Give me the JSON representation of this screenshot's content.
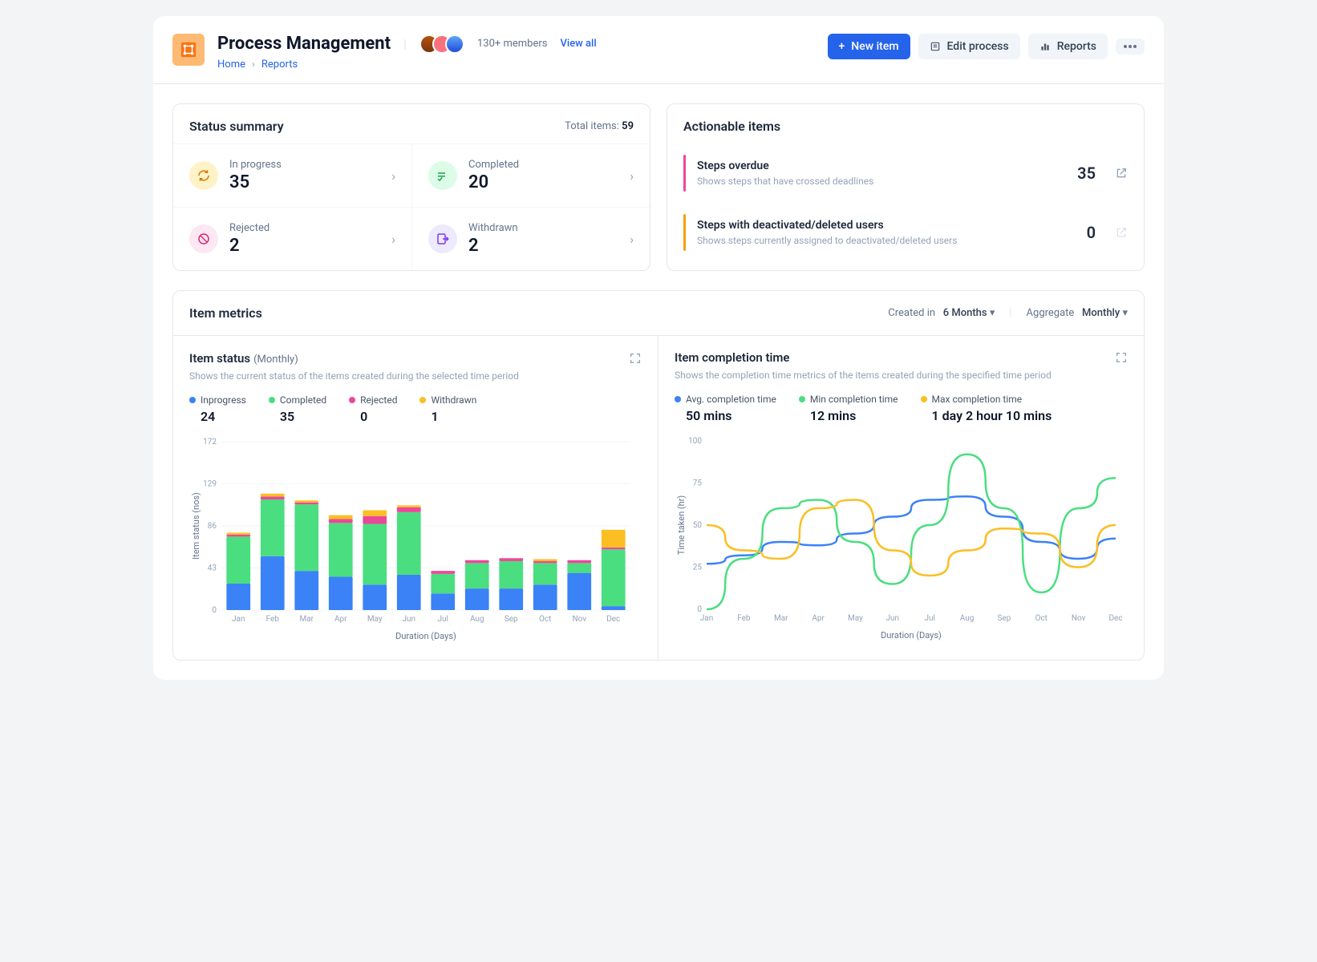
{
  "header": {
    "title": "Process Management",
    "members_text": "130+ members",
    "view_all": "View all",
    "breadcrumb": {
      "home": "Home",
      "current": "Reports"
    },
    "actions": {
      "new_item": "New item",
      "edit_process": "Edit process",
      "reports": "Reports"
    }
  },
  "status_summary": {
    "title": "Status summary",
    "total_label": "Total items: ",
    "total_value": "59",
    "cells": [
      {
        "label": "In progress",
        "value": "35",
        "icon": "refresh",
        "bg": "#fef3c7",
        "fg": "#d97706"
      },
      {
        "label": "Completed",
        "value": "20",
        "icon": "check",
        "bg": "#dcfce7",
        "fg": "#16a34a"
      },
      {
        "label": "Rejected",
        "value": "2",
        "icon": "forbid",
        "bg": "#fce7f3",
        "fg": "#db2777"
      },
      {
        "label": "Withdrawn",
        "value": "2",
        "icon": "exit",
        "bg": "#ede9fe",
        "fg": "#7c3aed"
      }
    ]
  },
  "actionable": {
    "title": "Actionable items",
    "items": [
      {
        "title": "Steps overdue",
        "desc": "Shows steps that have crossed deadlines",
        "count": "35",
        "color": "#ec4899",
        "active": true
      },
      {
        "title": "Steps with deactivated/deleted users",
        "desc": "Shows steps currently assigned to deactivated/deleted users",
        "count": "0",
        "color": "#f59e0b",
        "active": false
      }
    ]
  },
  "metrics": {
    "title": "Item metrics",
    "created_label": "Created in",
    "created_value": "6 Months",
    "aggregate_label": "Aggregate",
    "aggregate_value": "Monthly"
  },
  "item_status": {
    "title": "Item status",
    "sub": "(Monthly)",
    "desc": "Shows the current status of the items created during the selected time period",
    "legend": [
      {
        "label": "Inprogress",
        "value": "24",
        "color": "#3b82f6"
      },
      {
        "label": "Completed",
        "value": "35",
        "color": "#4ade80"
      },
      {
        "label": "Rejected",
        "value": "0",
        "color": "#ec4899"
      },
      {
        "label": "Withdrawn",
        "value": "1",
        "color": "#fbbf24"
      }
    ],
    "x_label": "Duration (Days)",
    "y_label": "Item status (nos)"
  },
  "completion": {
    "title": "Item completion time",
    "desc": "Shows the completion time metrics of the items created during the specified time period",
    "legend": [
      {
        "label": "Avg. completion time",
        "value": "50 mins",
        "color": "#3b82f6"
      },
      {
        "label": "Min completion time",
        "value": "12 mins",
        "color": "#4ade80"
      },
      {
        "label": "Max completion time",
        "value": "1 day 2 hour 10 mins",
        "color": "#fbbf24"
      }
    ],
    "x_label": "Duration (Days)",
    "y_label": "Time taken (hr)"
  },
  "chart_data": [
    {
      "type": "bar",
      "title": "Item status (Monthly)",
      "xlabel": "Duration (Days)",
      "ylabel": "Item status (nos)",
      "ylim": [
        0,
        172
      ],
      "y_ticks": [
        0,
        43,
        86,
        129,
        172
      ],
      "categories": [
        "Jan",
        "Feb",
        "Mar",
        "Apr",
        "May",
        "Jun",
        "Jul",
        "Aug",
        "Sep",
        "Oct",
        "Nov",
        "Dec"
      ],
      "series": [
        {
          "name": "Inprogress",
          "color": "#3b82f6",
          "values": [
            27,
            55,
            40,
            34,
            26,
            36,
            17,
            22,
            22,
            26,
            38,
            4
          ]
        },
        {
          "name": "Completed",
          "color": "#4ade80",
          "values": [
            48,
            58,
            68,
            55,
            62,
            64,
            20,
            26,
            28,
            22,
            10,
            58
          ]
        },
        {
          "name": "Rejected",
          "color": "#ec4899",
          "values": [
            2,
            3,
            2,
            4,
            8,
            5,
            3,
            3,
            3,
            2,
            3,
            2
          ]
        },
        {
          "name": "Withdrawn",
          "color": "#fbbf24",
          "values": [
            2,
            3,
            2,
            4,
            6,
            2,
            0,
            0,
            0,
            2,
            0,
            18
          ]
        }
      ]
    },
    {
      "type": "line",
      "title": "Item completion time",
      "xlabel": "Duration (Days)",
      "ylabel": "Time taken (hr)",
      "ylim": [
        0,
        100
      ],
      "y_ticks": [
        0,
        25,
        50,
        75,
        100
      ],
      "categories": [
        "Jan",
        "Feb",
        "Mar",
        "Apr",
        "May",
        "Jun",
        "Jul",
        "Aug",
        "Sep",
        "Oct",
        "Nov",
        "Dec"
      ],
      "series": [
        {
          "name": "Avg. completion time",
          "color": "#3b82f6",
          "values": [
            27,
            32,
            40,
            38,
            45,
            55,
            65,
            67,
            55,
            40,
            30,
            42
          ]
        },
        {
          "name": "Min completion time",
          "color": "#4ade80",
          "values": [
            0,
            30,
            60,
            65,
            40,
            15,
            50,
            92,
            60,
            10,
            60,
            78
          ]
        },
        {
          "name": "Max completion time",
          "color": "#fbbf24",
          "values": [
            50,
            35,
            30,
            60,
            65,
            35,
            20,
            35,
            48,
            45,
            25,
            50
          ]
        }
      ]
    }
  ]
}
